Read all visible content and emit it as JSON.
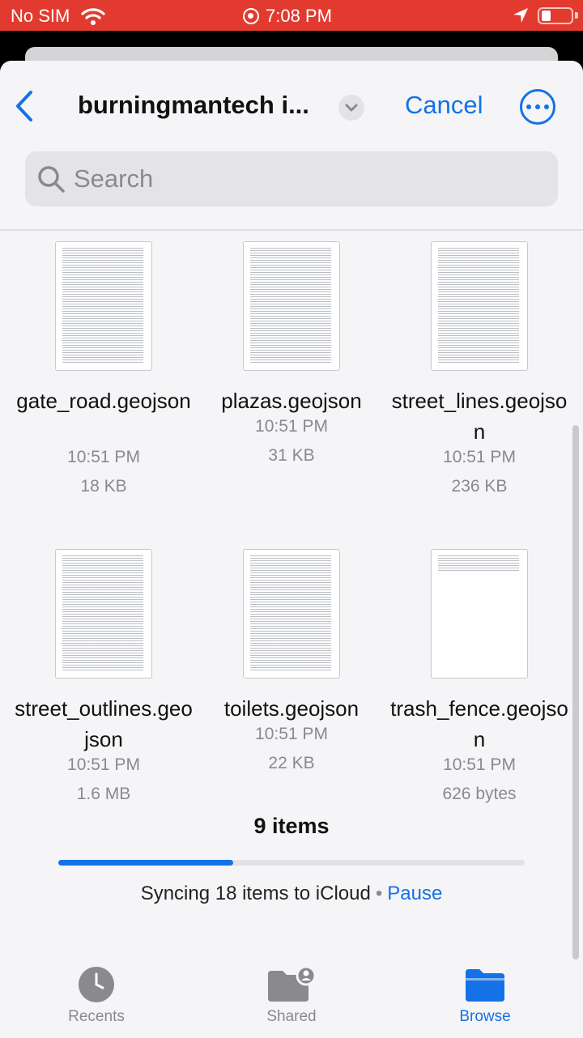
{
  "status_bar": {
    "carrier": "No SIM",
    "time": "7:08 PM"
  },
  "header": {
    "title": "burningmantech i...",
    "cancel_label": "Cancel"
  },
  "search": {
    "placeholder": "Search"
  },
  "files": [
    {
      "name": "gate_road.geojson",
      "time": "10:51 PM",
      "size": "18 KB"
    },
    {
      "name": "plazas.geojson",
      "time": "10:51 PM",
      "size": "31 KB"
    },
    {
      "name": "street_lines.geojson",
      "time": "10:51 PM",
      "size": "236 KB"
    },
    {
      "name": "street_outlines.geojson",
      "time": "10:51 PM",
      "size": "1.6 MB"
    },
    {
      "name": "toilets.geojson",
      "time": "10:51 PM",
      "size": "22 KB"
    },
    {
      "name": "trash_fence.geojson",
      "time": "10:51 PM",
      "size": "626 bytes"
    }
  ],
  "footer": {
    "items_count": "9 items",
    "sync_text": "Syncing 18 items to iCloud",
    "separator": "•",
    "pause_label": "Pause",
    "sync_progress_fraction": 0.375
  },
  "tabs": [
    {
      "label": "Recents",
      "icon": "clock-icon",
      "active": false
    },
    {
      "label": "Shared",
      "icon": "shared-folder-icon",
      "active": false
    },
    {
      "label": "Browse",
      "icon": "folder-icon",
      "active": true
    }
  ],
  "colors": {
    "accent": "#1472e6",
    "status_bar": "#e23a2f",
    "secondary_text": "#8a8a8e"
  }
}
